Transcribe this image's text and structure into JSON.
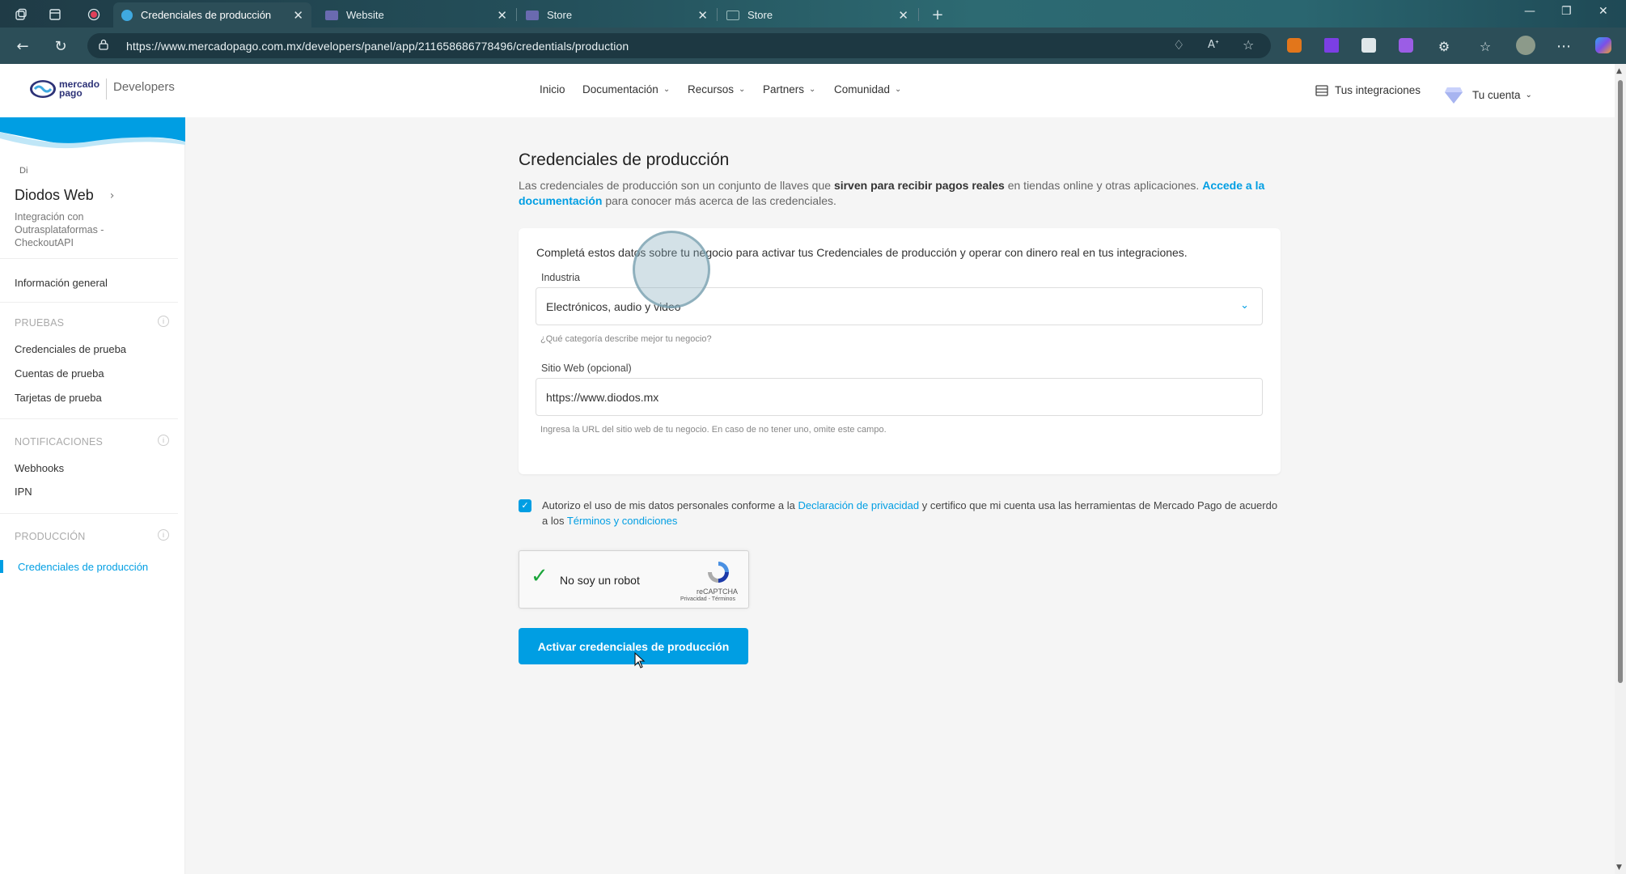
{
  "browser": {
    "tabs": [
      {
        "label": "Credenciales de producción",
        "active": true
      },
      {
        "label": "Website",
        "active": false
      },
      {
        "label": "Store",
        "active": false
      },
      {
        "label": "Store",
        "active": false
      }
    ],
    "new_tab": "+",
    "url": "https://www.mercadopago.com.mx/developers/panel/app/211658686778496/credentials/production"
  },
  "header": {
    "logo_line1": "mercado",
    "logo_line2": "pago",
    "developers": "Developers",
    "nav": [
      "Inicio",
      "Documentación",
      "Recursos",
      "Partners",
      "Comunidad"
    ],
    "integrations": "Tus integraciones",
    "account": "Tu cuenta"
  },
  "sidebar": {
    "initials": "Di",
    "app_name": "Diodos Web",
    "app_desc": "Integración con Outrasplataformas - CheckoutAPI",
    "general": "Información general",
    "sections": {
      "pruebas": "PRUEBAS",
      "notificaciones": "NOTIFICACIONES",
      "produccion": "PRODUCCIÓN"
    },
    "pruebas_items": [
      "Credenciales de prueba",
      "Cuentas de prueba",
      "Tarjetas de prueba"
    ],
    "notif_items": [
      "Webhooks",
      "IPN"
    ],
    "prod_items": [
      "Credenciales de producción"
    ]
  },
  "main": {
    "title": "Credenciales de producción",
    "desc_1": "Las credenciales de producción son un conjunto de llaves que ",
    "desc_bold": "sirven para recibir pagos reales",
    "desc_2": " en tiendas online y otras aplicaciones. ",
    "desc_link": "Accede a la documentación",
    "desc_3": " para conocer más acerca de las credenciales.",
    "card_intro": "Completá estos datos sobre tu negocio para activar tus Credenciales de producción y operar con dinero real en tus integraciones.",
    "industry_label": "Industria",
    "industry_value": "Electrónicos, audio y video",
    "industry_hint": "¿Qué categoría describe mejor tu negocio?",
    "site_label": "Sitio Web (opcional)",
    "site_value": "https://www.diodos.mx",
    "site_hint": "Ingresa la URL del sitio web de tu negocio. En caso de no tener uno, omite este campo.",
    "consent_1": "Autorizo el uso de mis datos personales conforme a la ",
    "consent_link1": "Declaración de privacidad",
    "consent_2": " y certifico que mi cuenta usa las herramientas de Mercado Pago de acuerdo a los ",
    "consent_link2": "Términos y condiciones",
    "consent_checked": true,
    "captcha_label": "No soy un robot",
    "captcha_brand": "reCAPTCHA",
    "captcha_links": "Privacidad - Términos",
    "activate_button": "Activar credenciales de producción"
  },
  "colors": {
    "accent": "#009ee3",
    "brand_navy": "#2d3277",
    "captcha_check": "#1ba53b"
  }
}
